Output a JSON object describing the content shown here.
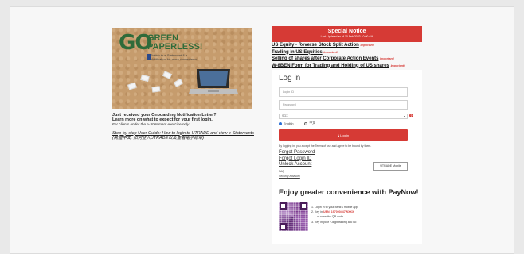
{
  "promo": {
    "go": "GO",
    "green_line1": "GREEN",
    "green_line2": "PAPERLESS!",
    "sub_text": "Switch to e-Statement & e-Notification for more convenience"
  },
  "left": {
    "headline1": "Just received your Onboarding Notification Letter?",
    "headline2": "Learn more on what to expect for your first login.",
    "note": "For clients under the e-Statement exercise only",
    "guide_link": "Step-by-step User Guide: How to login to UTRADE and view e-Statements",
    "guide_link_zh": "(简體中文: 如何登入UTRADE以及查看電子結單)"
  },
  "notice": {
    "title": "Special Notice",
    "updated": "Last Updated as of 10 Feb 2023 10:00 AM",
    "items": [
      {
        "text": "US Equity - Reverse Stock Split Action",
        "tag": "Important!"
      },
      {
        "text": "Trading in US Equities",
        "tag": "Important!"
      },
      {
        "text": "Selling of shares after Corporate Action Events",
        "tag": "Important!"
      },
      {
        "text": "W-8BEN Form for Trading and Holding of US shares",
        "tag": "Important!"
      }
    ]
  },
  "login": {
    "title": "Log in",
    "login_id_placeholder": "Login ID",
    "password_placeholder": "Password",
    "market_value": "SGX",
    "lang_english": "English",
    "lang_chinese": "中文",
    "button": "Log in",
    "terms": "By logging in, you accept the Terms of use and agree to be bound by them.",
    "forgot_password": "Forgot Password",
    "forgot_login": "Forgot Login ID",
    "unlock": "Unlock Account",
    "faq": "FAQ",
    "security": "Security Advisory",
    "utrade_mobile": "UTRADE Mobile"
  },
  "paynow": {
    "title": "Enjoy greater convenience with PayNow!",
    "step1": "1. Login in to your bank's mobile app",
    "step2a": "2. Key in ",
    "step2b": "UEN: 197000447WXXX",
    "step2c": "or scan the QR code",
    "step3": "3. Key in your 7-digit trading acc no"
  }
}
